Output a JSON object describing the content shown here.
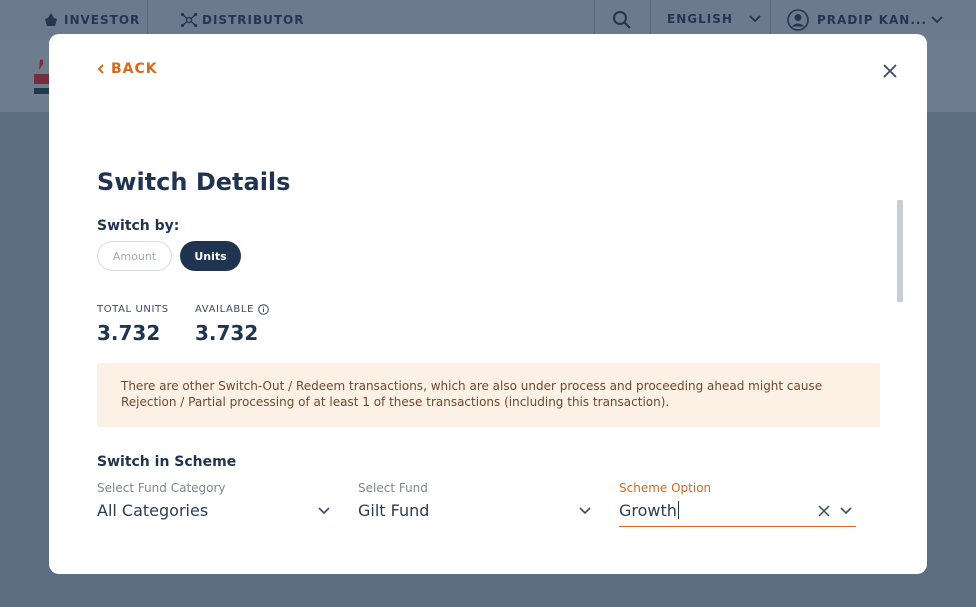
{
  "topnav": {
    "investor": "INVESTOR",
    "distributor": "DISTRIBUTOR",
    "language": "ENGLISH",
    "user": "PRADIP KAN..."
  },
  "modal": {
    "back_label": "BACK",
    "title": "Switch Details",
    "switch_by_label": "Switch by:",
    "options": {
      "amount": "Amount",
      "units": "Units"
    },
    "selected_option": "Units",
    "total_units_label": "TOTAL UNITS",
    "total_units_value": "3.732",
    "available_label": "AVAILABLE",
    "available_value": "3.732",
    "warning_text": "There are other Switch-Out / Redeem transactions, which are also under process and proceeding ahead might cause Rejection / Partial processing of at least 1 of these transactions (including this transaction).",
    "switch_in_title": "Switch in Scheme",
    "fund_category": {
      "label": "Select Fund Category",
      "value": "All Categories"
    },
    "fund": {
      "label": "Select Fund",
      "value": "Gilt Fund"
    },
    "scheme_option": {
      "label": "Scheme Option",
      "value": "Growth"
    }
  },
  "colors": {
    "accent": "#d4691f",
    "navy": "#1f3450",
    "warning_bg": "#fdf1e6"
  }
}
